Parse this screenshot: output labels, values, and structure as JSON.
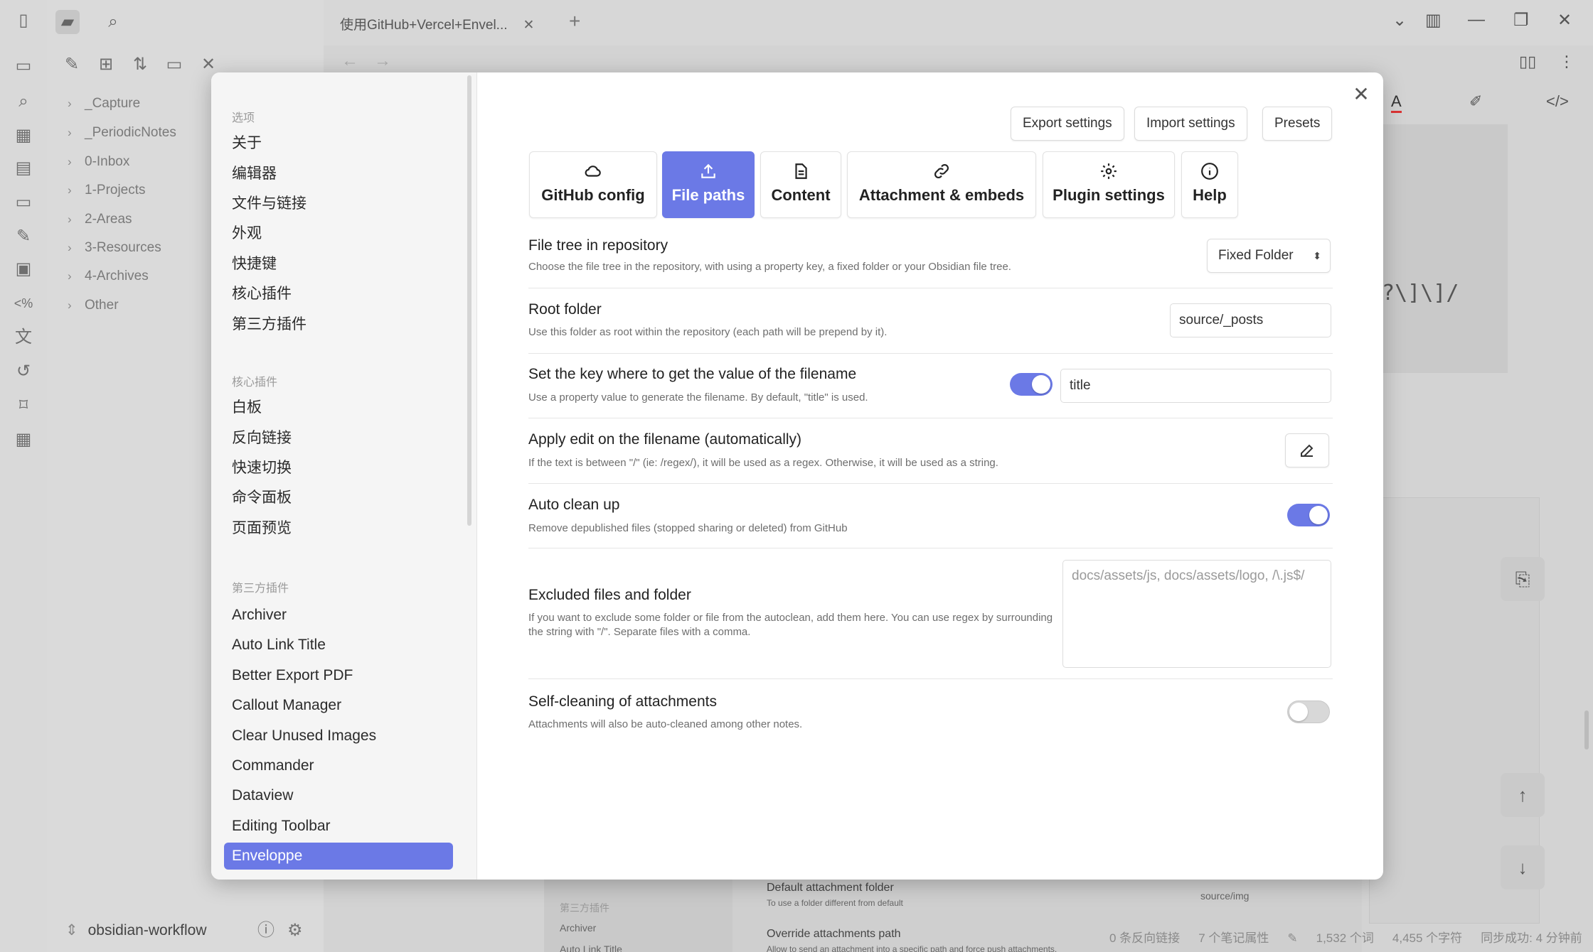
{
  "window": {
    "tab_title": "使用GitHub+Vercel+Envel...",
    "tab_close": "✕",
    "tab_new": "+",
    "minimize": "—",
    "restore": "❐",
    "close": "✕"
  },
  "file_tree": [
    "_Capture",
    "_PeriodicNotes",
    "0-Inbox",
    "1-Projects",
    "2-Areas",
    "3-Resources",
    "4-Archives",
    "Other"
  ],
  "vault": {
    "name": "obsidian-workflow"
  },
  "background": {
    "code_snippet": ")?\\]\\]/",
    "panel_section": "第三方插件",
    "panel_items": [
      "Archiver",
      "Auto Link Title"
    ],
    "attachment_folder_label": "Default attachment folder",
    "attachment_folder_desc": "To use a folder different from default",
    "attachment_folder_value": "source/img",
    "override_label": "Override attachments path",
    "override_desc": "Allow to send an attachment into a specific path and force push attachments."
  },
  "statusbar": {
    "backlinks": "0 条反向链接",
    "properties": "7 个笔记属性",
    "words": "1,532 个词",
    "chars": "4,455 个字符",
    "sync": "同步成功: 4 分钟前"
  },
  "settings_nav": {
    "section_options": "选项",
    "options": [
      "关于",
      "编辑器",
      "文件与链接",
      "外观",
      "快捷键",
      "核心插件",
      "第三方插件"
    ],
    "section_core": "核心插件",
    "core": [
      "白板",
      "反向链接",
      "快速切换",
      "命令面板",
      "页面预览"
    ],
    "section_community": "第三方插件",
    "community": [
      "Archiver",
      "Auto Link Title",
      "Better Export PDF",
      "Callout Manager",
      "Clear Unused Images",
      "Commander",
      "Dataview",
      "Editing Toolbar",
      "Enveloppe"
    ],
    "active": "Enveloppe"
  },
  "plugin": {
    "close_label": "✕",
    "top_buttons": {
      "export": "Export settings",
      "import": "Import settings",
      "presets": "Presets"
    },
    "tabs": [
      {
        "label": "GitHub config",
        "icon": "cloud-icon"
      },
      {
        "label": "File paths",
        "icon": "upload-icon",
        "active": true
      },
      {
        "label": "Content",
        "icon": "document-icon"
      },
      {
        "label": "Attachment & embeds",
        "icon": "link-icon"
      },
      {
        "label": "Plugin settings",
        "icon": "gear-icon"
      },
      {
        "label": "Help",
        "icon": "info-icon"
      }
    ],
    "settings": {
      "file_tree": {
        "name": "File tree in repository",
        "desc": "Choose the file tree in the repository, with using a property key, a fixed folder or your Obsidian file tree.",
        "value": "Fixed Folder"
      },
      "root_folder": {
        "name": "Root folder",
        "desc": "Use this folder as root within the repository (each path will be prepend by it).",
        "value": "source/_posts"
      },
      "filename_key": {
        "name": "Set the key where to get the value of the filename",
        "desc": "Use a property value to generate the filename. By default, \"title\" is used.",
        "enabled": true,
        "value": "title"
      },
      "apply_edit": {
        "name": "Apply edit on the filename (automatically)",
        "desc": "If the text is between \"/\" (ie: /regex/), it will be used as a regex. Otherwise, it will be used as a string."
      },
      "auto_clean": {
        "name": "Auto clean up",
        "desc": "Remove depublished files (stopped sharing or deleted) from GitHub",
        "enabled": true
      },
      "excluded": {
        "name": "Excluded files and folder",
        "desc": "If you want to exclude some folder or file from the autoclean, add them here. You can use regex by surrounding the string with \"/\". Separate files with a comma.",
        "placeholder": "docs/assets/js, docs/assets/logo, /\\.js$/"
      },
      "self_cleaning": {
        "name": "Self-cleaning of attachments",
        "desc": "Attachments will also be auto-cleaned among other notes.",
        "enabled": false
      }
    }
  },
  "colors": {
    "accent": "#6b79e6",
    "background": "#d3d3d3",
    "modal": "#ffffff"
  }
}
